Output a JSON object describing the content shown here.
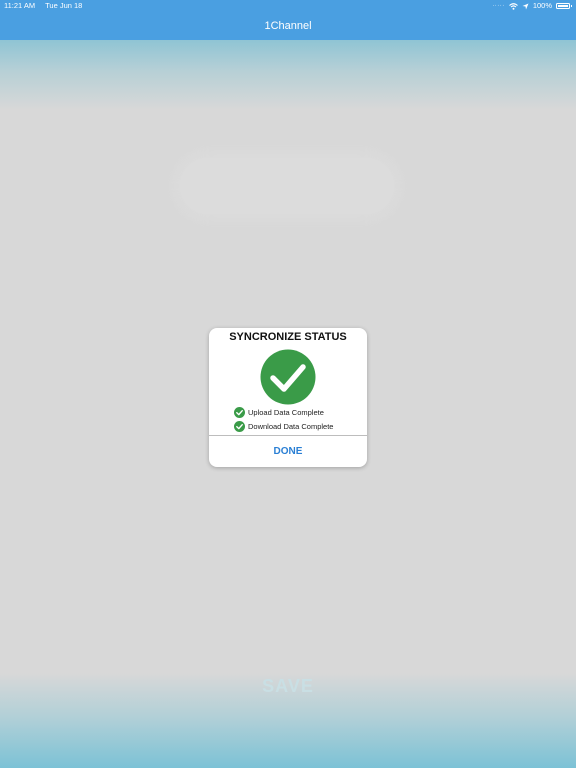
{
  "status_bar": {
    "time": "11:21 AM",
    "date": "Tue Jun 18",
    "battery_percent": "100%",
    "icons": [
      "signal-icon",
      "wifi-icon",
      "location-icon",
      "battery-icon"
    ]
  },
  "nav": {
    "title": "1Channel"
  },
  "background": {
    "save_label": "SAVE"
  },
  "dialog": {
    "title": "SYNCRONIZE STATUS",
    "status_items": [
      {
        "label": "Upload Data Complete",
        "icon": "check-circle-icon"
      },
      {
        "label": "Download Data Complete",
        "icon": "check-circle-icon"
      }
    ],
    "done_label": "DONE"
  },
  "colors": {
    "nav_blue": "#4a9fe1",
    "success_green": "#3a9b48",
    "action_blue": "#2a7fd4"
  }
}
